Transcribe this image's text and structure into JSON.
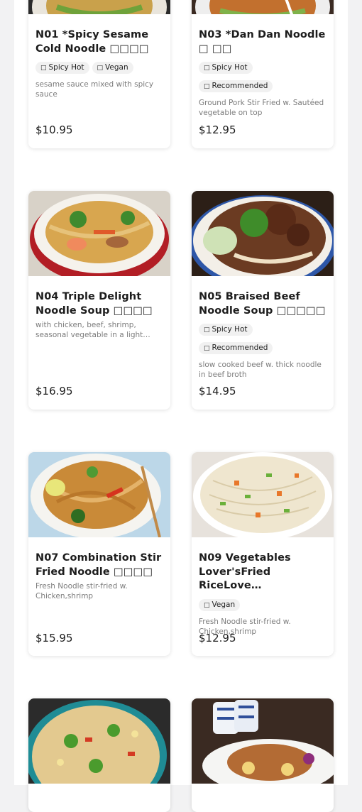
{
  "menu": {
    "items": [
      {
        "code_title": "N01 *Spicy Sesame Cold Noodle □□□□",
        "tags": [
          {
            "icon": "□",
            "label": "Spicy Hot"
          },
          {
            "icon": "□",
            "label": "Vegan"
          }
        ],
        "description": "sesame sauce mixed with spicy sauce",
        "price": "$10.95"
      },
      {
        "code_title": "N03 *Dan Dan Noodle □ □□",
        "tags": [
          {
            "icon": "□",
            "label": "Spicy Hot"
          },
          {
            "icon": "□",
            "label": "Recommended"
          }
        ],
        "description": "Ground Pork Stir Fried w. Sautéed vegetable on top",
        "price": "$12.95"
      },
      {
        "code_title": "N04 Triple Delight Noodle Soup □□□□",
        "tags": [],
        "description": "with chicken, beef, shrimp, seasonal vegetable in a light…",
        "price": "$16.95"
      },
      {
        "code_title": "N05 Braised Beef Noodle Soup □□□□□",
        "tags": [
          {
            "icon": "□",
            "label": "Spicy Hot"
          },
          {
            "icon": "□",
            "label": "Recommended"
          }
        ],
        "description": "slow cooked beef w. thick noodle in beef broth",
        "price": "$14.95"
      },
      {
        "code_title": "N07 Combination Stir Fried Noodle □□□□",
        "tags": [],
        "description": "Fresh Noodle stir-fried w. Chicken,shrimp",
        "price": "$15.95"
      },
      {
        "code_title": "N09 Vegetables Lover'sFried RiceLove…",
        "tags": [
          {
            "icon": "□",
            "label": "Vegan"
          }
        ],
        "description": "Fresh Noodle stir-fried w. Chicken,shrimp",
        "price": "$12.95"
      }
    ]
  }
}
